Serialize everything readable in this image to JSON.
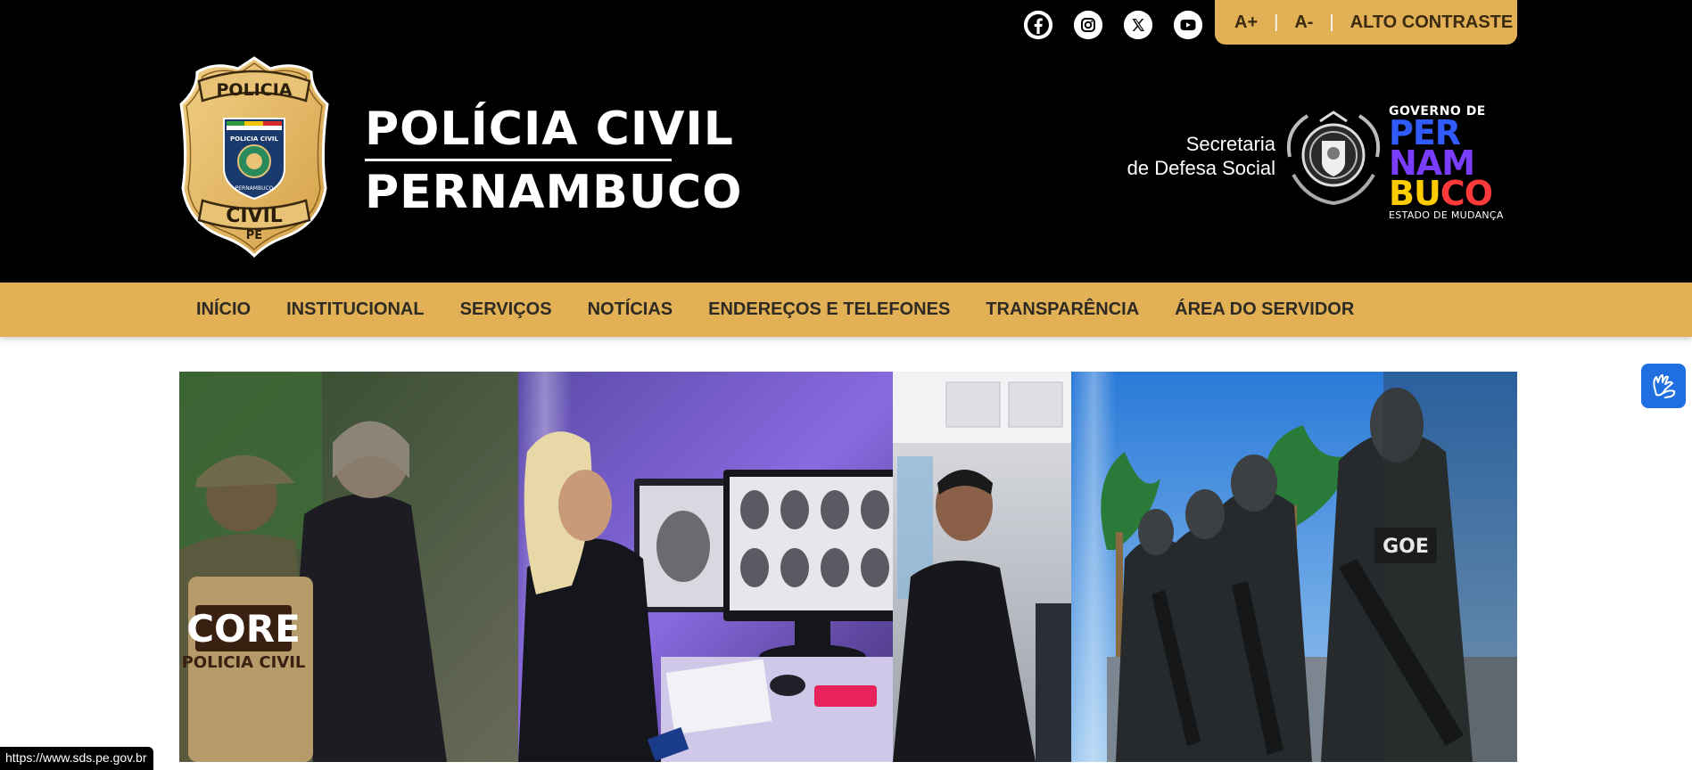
{
  "social": [
    {
      "name": "Facebook",
      "icon": "facebook-icon"
    },
    {
      "name": "Instagram",
      "icon": "instagram-icon"
    },
    {
      "name": "X",
      "icon": "x-icon"
    },
    {
      "name": "YouTube",
      "icon": "youtube-icon"
    }
  ],
  "accessibility": {
    "increase_font": "A+",
    "decrease_font": "A-",
    "high_contrast": "ALTO CONTRASTE",
    "separator": "|"
  },
  "badge": {
    "top_text": "POLICIA",
    "bottom_text": "CIVIL",
    "state": "PE",
    "shield_text": "POLICIA CIVIL",
    "shield_sub": "PERNAMBUCO"
  },
  "brand": {
    "line1": "POLÍCIA CIVIL",
    "line2": "PERNAMBUCO"
  },
  "sds": {
    "line1": "Secretaria",
    "line2": "de Defesa Social"
  },
  "governo": {
    "top": "GOVERNO DE",
    "per": "PER",
    "nam": "NAM",
    "buco": "BUCO",
    "tagline": "ESTADO DE MUDANÇA"
  },
  "nav": {
    "items": [
      {
        "label": "INÍCIO"
      },
      {
        "label": "INSTITUCIONAL"
      },
      {
        "label": "SERVIÇOS"
      },
      {
        "label": "NOTÍCIAS"
      },
      {
        "label": "ENDEREÇOS E TELEFONES"
      },
      {
        "label": "TRANSPARÊNCIA"
      },
      {
        "label": "ÁREA DO SERVIDOR"
      }
    ]
  },
  "hero": {
    "vest_text1": "CORE",
    "vest_text2": "POLICIA CIVIL",
    "goe_text": "GOE"
  },
  "status_url": "https://www.sds.pe.gov.br",
  "colors": {
    "header_bg": "#000000",
    "accent_gold": "#e2b055",
    "libras_blue": "#1f6fe0"
  }
}
